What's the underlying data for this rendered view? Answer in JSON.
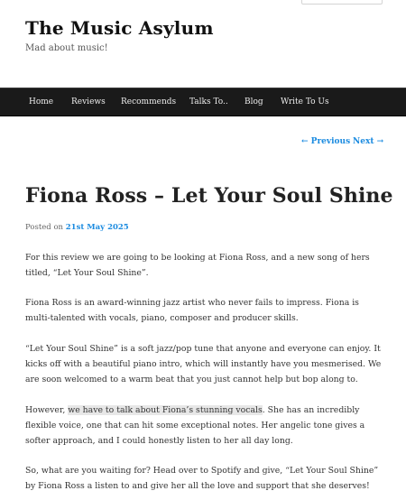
{
  "site": {
    "title": "The Music Asylum",
    "description": "Mad about music!"
  },
  "nav": {
    "items": [
      "Home",
      "Reviews",
      "Recommends",
      "Talks To..",
      "Blog",
      "Write To Us"
    ]
  },
  "post_nav": {
    "previous": "← Previous",
    "next": "Next →"
  },
  "post": {
    "title": "Fiona Ross – Let Your Soul Shine",
    "posted_prefix": "Posted on ",
    "posted_date": "21st May 2025",
    "p1": "For this review we are going to be looking at Fiona Ross, and a new song of hers titled, “Let Your Soul Shine”.",
    "p2": "Fiona Ross is an award-winning jazz artist who never fails to impress. Fiona is multi-talented with vocals, piano, composer and producer skills.",
    "p3": "“Let Your Soul Shine” is a soft jazz/pop tune that anyone and everyone can enjoy. It kicks off with a beautiful piano intro, which will instantly have you mesmerised. We are soon welcomed to a warm beat that you just cannot help but bop along to.",
    "p4_before": "However, ",
    "p4_highlight": "we have to talk about Fiona’s stunning vocals",
    "p4_after": ". She has an incredibly flexible voice, one that can hit some exceptional notes. Her angelic tone gives a softer approach, and I could honestly listen to her all day long.",
    "p5": "So, what are you waiting for? Head over to Spotify and give, “Let Your Soul Shine” by Fiona Ross a listen to and give her all the love and support that she deserves!"
  }
}
